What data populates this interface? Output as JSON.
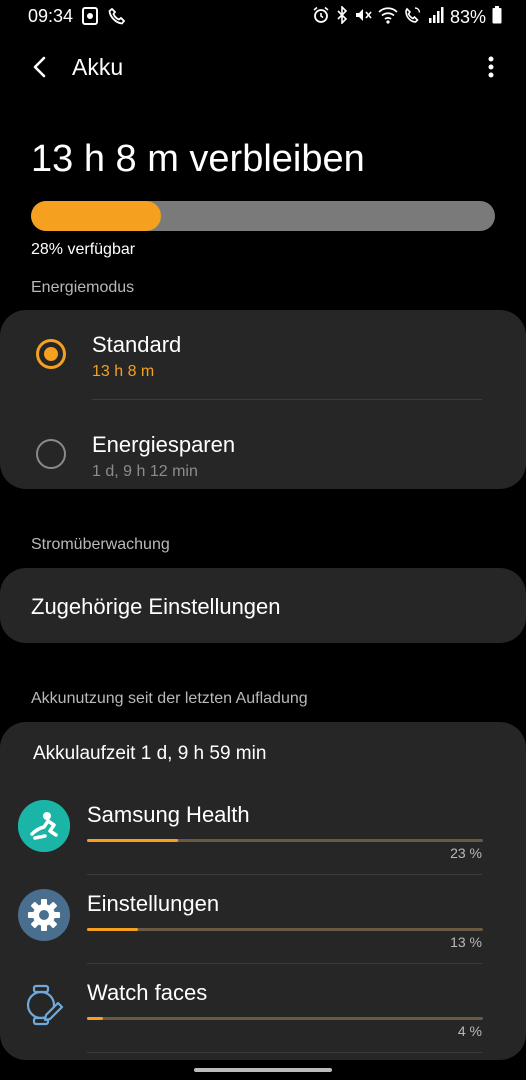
{
  "status_bar": {
    "time": "09:34",
    "battery_pct": "83%",
    "icons": [
      "screenshot-icon",
      "call-icon",
      "alarm-icon",
      "bluetooth-icon",
      "mute-icon",
      "wifi-icon",
      "wifi-call-icon",
      "signal-icon",
      "battery-icon"
    ]
  },
  "app_bar": {
    "title": "Akku",
    "back_icon": "back-arrow-icon",
    "more_icon": "more-vert-icon"
  },
  "battery": {
    "remaining_text": "13 h 8 m verbleiben",
    "available_text": "28% verfügbar",
    "level_fraction": 0.28,
    "fill_color": "#f5a01f",
    "track_color": "#7a7a7a"
  },
  "power_mode": {
    "section_label": "Energiemodus",
    "options": [
      {
        "label": "Standard",
        "sub": "13 h 8 m",
        "selected": true
      },
      {
        "label": "Energiesparen",
        "sub": "1 d, 9 h 12 min",
        "selected": false
      }
    ]
  },
  "monitoring": {
    "section_label": "Stromüberwachung",
    "item_label": "Zugehörige Einstellungen"
  },
  "usage": {
    "section_label": "Akkunutzung seit der letzten Aufladung",
    "uptime_text": "Akkulaufzeit 1 d, 9 h 59 min",
    "apps": [
      {
        "name": "Samsung Health",
        "percent_text": "23 %",
        "fraction": 0.23,
        "icon": "samsung-health-icon"
      },
      {
        "name": "Einstellungen",
        "percent_text": "13 %",
        "fraction": 0.13,
        "icon": "settings-gear-icon"
      },
      {
        "name": "Watch faces",
        "percent_text": "4 %",
        "fraction": 0.04,
        "icon": "watch-face-icon"
      }
    ]
  },
  "colors": {
    "accent": "#f5a01f",
    "card_bg": "#262626",
    "background": "#000000"
  }
}
